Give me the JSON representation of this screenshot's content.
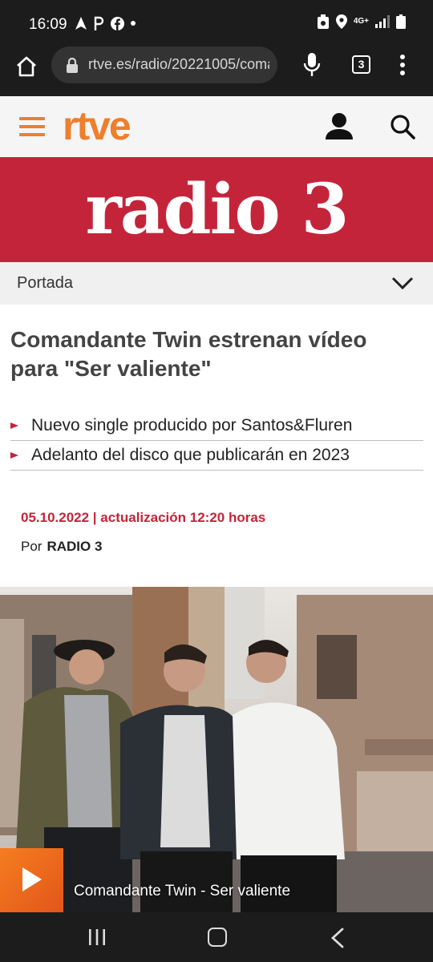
{
  "status_bar": {
    "time": "16:09",
    "network": "4G+",
    "left_icons": [
      "navigation-icon",
      "p-icon",
      "facebook-icon",
      "dot-icon"
    ],
    "right_icons": [
      "recycle-icon",
      "location-icon",
      "network-icon",
      "signal-icon",
      "battery-icon"
    ]
  },
  "browser": {
    "url": "rtve.es/radio/20221005/comandante",
    "tab_count": "3"
  },
  "site": {
    "brand": "rtve",
    "brand_color": "#ee7f2d",
    "banner_logo": "radio 3",
    "banner_color": "#c4243a",
    "section": "Portada"
  },
  "article": {
    "title": "Comandante Twin estrenan vídeo para \"Ser valiente\"",
    "bullets": [
      "Nuevo single producido por Santos&Fluren",
      "Adelanto del disco que publicarán en 2023"
    ],
    "date_line": "05.10.2022 | actualización 12:20 horas",
    "author_prefix": "Por",
    "author": "RADIO 3"
  },
  "player": {
    "title": "Comandante Twin - Ser valiente"
  }
}
